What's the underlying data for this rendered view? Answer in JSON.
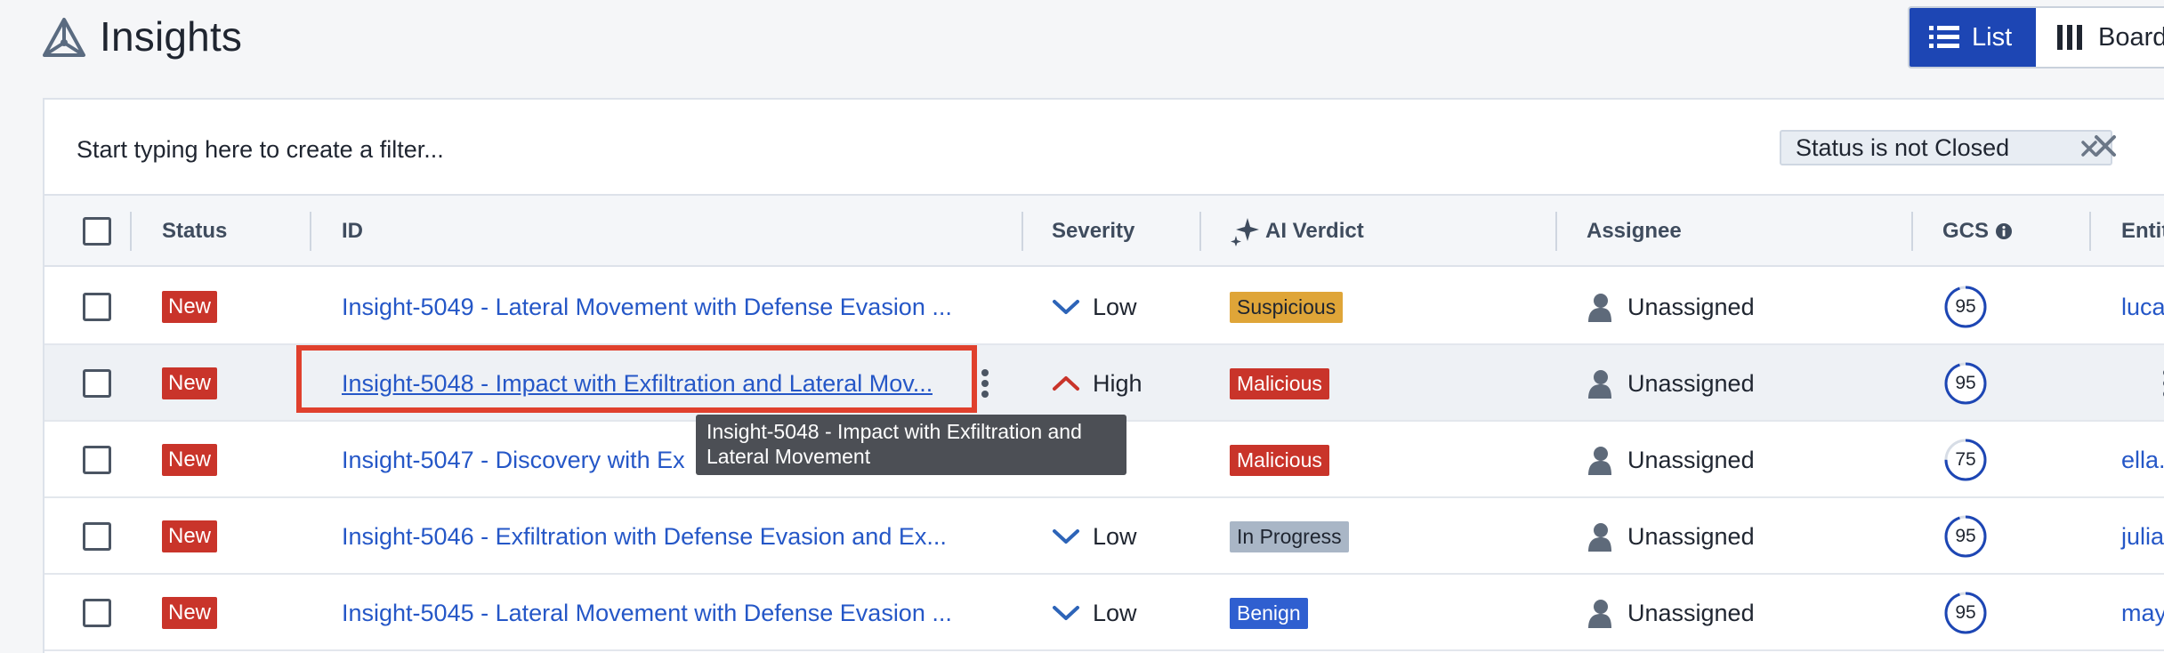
{
  "page": {
    "title": "Insights"
  },
  "view_toggle": [
    {
      "label": "List",
      "icon": "list-icon",
      "active": true
    },
    {
      "label": "Board",
      "icon": "board-columns-icon",
      "active": false
    }
  ],
  "filter": {
    "placeholder": "Start typing here to create a filter...",
    "chip": "Status is not Closed"
  },
  "columns": {
    "status": "Status",
    "id": "ID",
    "severity": "Severity",
    "ai_verdict": "AI Verdict",
    "assignee": "Assignee",
    "gcs": "GCS",
    "entity": "Entit"
  },
  "rows": [
    {
      "status": "New",
      "title": "Insight-5049 - Lateral Movement with Defense Evasion ...",
      "severity": "Low",
      "severity_dir": "down",
      "verdict": "Suspicious",
      "verdict_color": "#dfa538",
      "assignee": "Unassigned",
      "gcs": 95,
      "entity": "luca"
    },
    {
      "status": "New",
      "title": "Insight-5048 - Impact with Exfiltration and Lateral Mov...",
      "severity": "High",
      "severity_dir": "up",
      "verdict": "Malicious",
      "verdict_color": "#c9342a",
      "assignee": "Unassigned",
      "gcs": 95,
      "entity": ""
    },
    {
      "status": "New",
      "title": "Insight-5047 - Discovery with Ex",
      "severity": "gh",
      "severity_dir": "none",
      "verdict": "Malicious",
      "verdict_color": "#c9342a",
      "assignee": "Unassigned",
      "gcs": 75,
      "entity": "ella."
    },
    {
      "status": "New",
      "title": "Insight-5046 - Exfiltration with Defense Evasion and Ex...",
      "severity": "Low",
      "severity_dir": "down",
      "verdict": "In Progress",
      "verdict_color": "#a9b6c6",
      "assignee": "Unassigned",
      "gcs": 95,
      "entity": "julia"
    },
    {
      "status": "New",
      "title": "Insight-5045 - Lateral Movement with Defense Evasion ...",
      "severity": "Low",
      "severity_dir": "down",
      "verdict": "Benign",
      "verdict_color": "#2f5fd0",
      "assignee": "Unassigned",
      "gcs": 95,
      "entity": "may"
    }
  ],
  "tooltip": {
    "line1": "Insight-5048 - Impact with Exfiltration and",
    "line2": "Lateral Movement"
  },
  "colors": {
    "accent": "#1d46b4",
    "link": "#2557c7",
    "new_badge": "#c9342a",
    "highlight": "#e0402d"
  }
}
